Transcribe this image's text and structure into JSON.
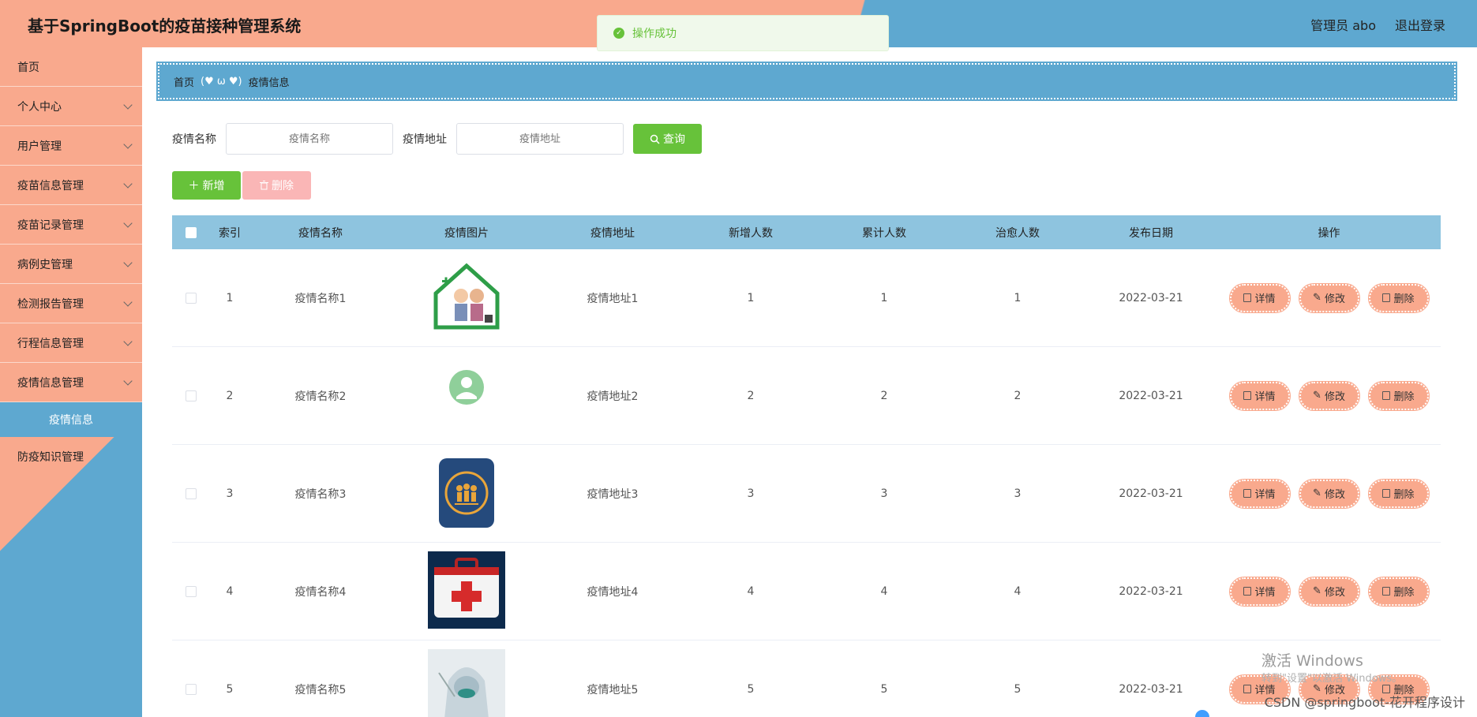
{
  "header": {
    "title": "基于SpringBoot的疫苗接种管理系统",
    "user": "管理员 abo",
    "logout": "退出登录"
  },
  "toast": {
    "message": "操作成功"
  },
  "sidebar": {
    "items": [
      {
        "label": "首页"
      },
      {
        "label": "个人中心"
      },
      {
        "label": "用户管理"
      },
      {
        "label": "疫苗信息管理"
      },
      {
        "label": "疫苗记录管理"
      },
      {
        "label": "病例史管理"
      },
      {
        "label": "检测报告管理"
      },
      {
        "label": "行程信息管理"
      },
      {
        "label": "疫情信息管理"
      }
    ],
    "active_sub": "疫情信息",
    "last_item": "防疫知识管理"
  },
  "breadcrumb": {
    "home": "首页",
    "sep": "(♥ ω ♥)",
    "current": "疫情信息"
  },
  "search": {
    "name_label": "疫情名称",
    "name_placeholder": "疫情名称",
    "addr_label": "疫情地址",
    "addr_placeholder": "疫情地址",
    "query": "查询"
  },
  "actions": {
    "add": "新增",
    "delete": "删除"
  },
  "table": {
    "headers": [
      "索引",
      "疫情名称",
      "疫情图片",
      "疫情地址",
      "新增人数",
      "累计人数",
      "治愈人数",
      "发布日期",
      "操作"
    ],
    "rows": [
      {
        "idx": "1",
        "name": "疫情名称1",
        "img": "house-care-image",
        "addr": "疫情地址1",
        "new": "1",
        "total": "1",
        "cured": "1",
        "date": "2022-03-21"
      },
      {
        "idx": "2",
        "name": "疫情名称2",
        "img": "doctor-avatar-image",
        "addr": "疫情地址2",
        "new": "2",
        "total": "2",
        "cured": "2",
        "date": "2022-03-21"
      },
      {
        "idx": "3",
        "name": "疫情名称3",
        "img": "family-icon-image",
        "addr": "疫情地址3",
        "new": "3",
        "total": "3",
        "cured": "3",
        "date": "2022-03-21"
      },
      {
        "idx": "4",
        "name": "疫情名称4",
        "img": "first-aid-kit-image",
        "addr": "疫情地址4",
        "new": "4",
        "total": "4",
        "cured": "4",
        "date": "2022-03-21"
      },
      {
        "idx": "5",
        "name": "疫情名称5",
        "img": "protective-suit-image",
        "addr": "疫情地址5",
        "new": "5",
        "total": "5",
        "cured": "5",
        "date": "2022-03-21"
      }
    ],
    "ops": {
      "detail": "详情",
      "edit": "修改",
      "delete": "删除"
    }
  },
  "watermark": {
    "line1": "激活 Windows",
    "line2": "转到\"设置\"以激活 Windows。"
  },
  "corner_tag": "CSDN @springboot-花开程序设计",
  "colors": {
    "salmon": "#f9a98d",
    "blue": "#5ea8d0",
    "green": "#67c23a",
    "header_row": "#8ec4df"
  }
}
